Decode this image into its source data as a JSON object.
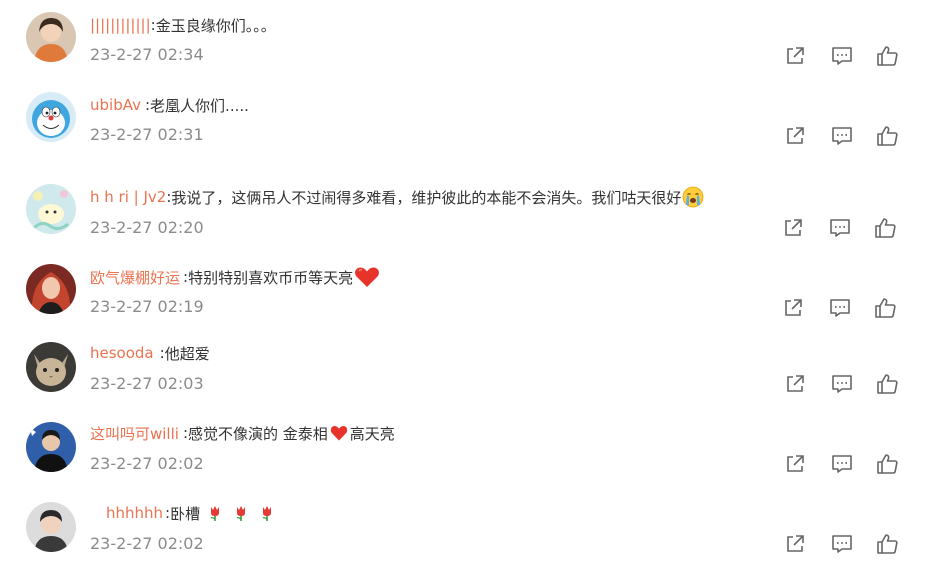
{
  "colors": {
    "username": "#eb7350",
    "text": "#333333",
    "timestamp": "#8b8b8b",
    "icon": "#666666"
  },
  "comments": [
    {
      "username": "||||||||||||",
      "separator": ":",
      "text": "金玉良缘你们。。。",
      "emoji": "",
      "time": "23-2-27 02:34",
      "icons": [
        "share-icon",
        "reply-icon",
        "like-icon"
      ]
    },
    {
      "username": "ubibAv",
      "separator": ":",
      "text": "老凰人你们.....",
      "emoji": "",
      "time": "23-2-27 02:31",
      "icons": [
        "share-icon",
        "reply-icon",
        "like-icon"
      ]
    },
    {
      "username": "h h ri | Jv2",
      "separator": ":",
      "text": "我说了，这俩吊人不过闹得多难看，维护彼此的本能不会消失。我们咕天很好",
      "emoji": "crying-face-emoji",
      "time": "23-2-27 02:20",
      "icons": [
        "share-icon",
        "reply-icon",
        "like-icon"
      ]
    },
    {
      "username": "欧气爆棚好运",
      "separator": ":",
      "text": "特别特别喜欢币币等天亮",
      "emoji": "red-heart-emoji",
      "time": "23-2-27 02:19",
      "icons": [
        "share-icon",
        "reply-icon",
        "like-icon"
      ]
    },
    {
      "username": "hesooda",
      "separator": ":",
      "text": "他超爱",
      "emoji": "",
      "time": "23-2-27 02:03",
      "icons": [
        "share-icon",
        "reply-icon",
        "like-icon"
      ]
    },
    {
      "username": "这叫吗可willi",
      "separator": ":",
      "text_before": "感觉不像演的 金泰相",
      "emoji": "red-heart-emoji",
      "text_after": "高天亮",
      "time": "23-2-27 02:02",
      "icons": [
        "share-icon",
        "reply-icon",
        "like-icon"
      ]
    },
    {
      "username": "hhhhhh",
      "separator": ":",
      "text": "卧槽",
      "emoji": "tulip-emoji",
      "time": "23-2-27 02:02",
      "icons": [
        "share-icon",
        "reply-icon",
        "like-icon"
      ]
    }
  ]
}
